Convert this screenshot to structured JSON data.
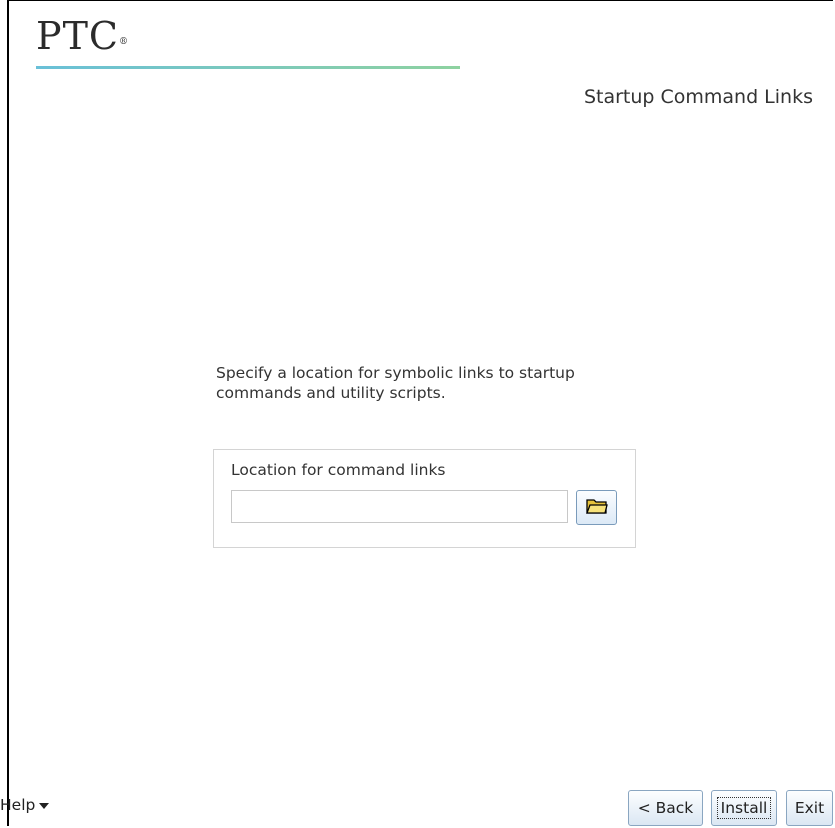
{
  "header": {
    "logo_text": "PTC",
    "logo_mark": "®",
    "page_title": "Startup Command Links"
  },
  "main": {
    "instructions": "Specify a location for symbolic links to startup commands and utility scripts.",
    "location_label": "Location for command links",
    "location_value": "",
    "browse_icon": "folder-icon"
  },
  "footer": {
    "help_label": "Help",
    "back_label": "< Back",
    "install_label": "Install",
    "exit_label": "Exit"
  }
}
